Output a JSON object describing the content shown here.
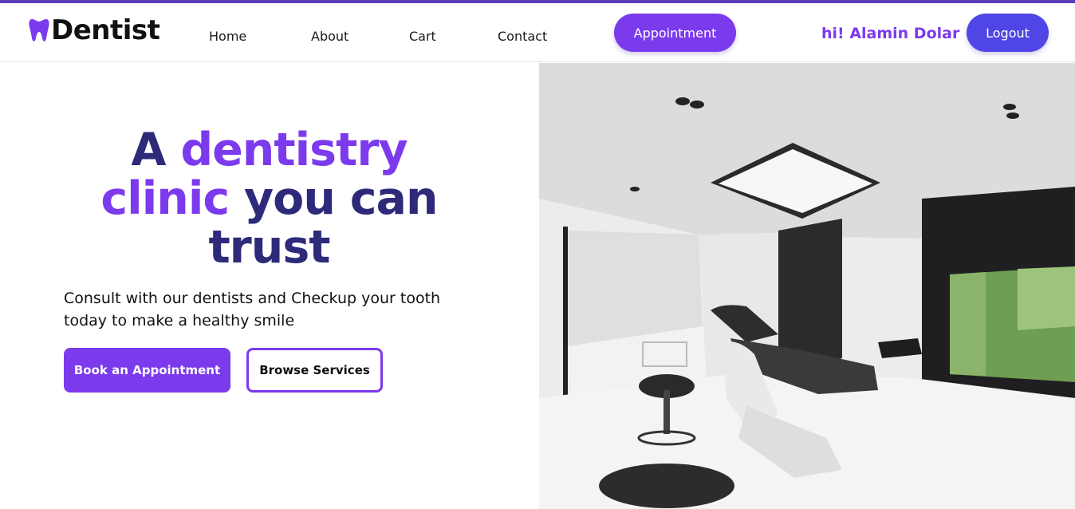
{
  "brand": {
    "name": "Dentist",
    "accent_color": "#7c3aed",
    "icon": "tooth-icon"
  },
  "nav": {
    "links": [
      {
        "label": "Home"
      },
      {
        "label": "About"
      },
      {
        "label": "Cart"
      },
      {
        "label": "Contact"
      }
    ],
    "appointment_label": "Appointment",
    "greeting": "hi! Alamin Dolar",
    "logout_label": "Logout"
  },
  "hero": {
    "title_part1": "A ",
    "title_accent1": "dentistry",
    "title_accent2": "clinic",
    "title_part2": " you can trust",
    "subtitle": "Consult with our dentists and Checkup your tooth today to make a healthy smile",
    "primary_cta": "Book an Appointment",
    "secondary_cta": "Browse Services",
    "image_description_icon": "dental-clinic-photo"
  },
  "colors": {
    "primary_purple": "#7c3aed",
    "indigo_button": "#4f46e5",
    "title_dark": "#2e2a7a",
    "top_accent": "#5b3fb6"
  }
}
